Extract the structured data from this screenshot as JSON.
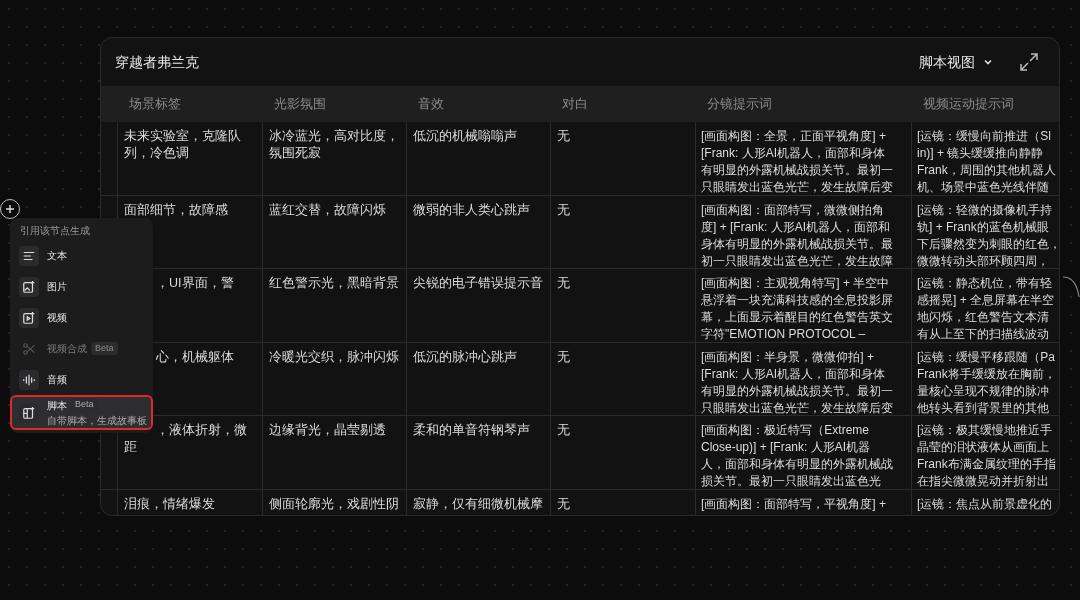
{
  "card": {
    "title": "穿越者弗兰克",
    "view_menu": "脚本视图"
  },
  "table": {
    "columns": [
      "场景标签",
      "光影氛围",
      "音效",
      "对白",
      "分镜提示词",
      "视频运动提示词"
    ],
    "rows": [
      {
        "partly_hidden": false,
        "cells": [
          [
            "未来实验室，克隆队",
            "列，冷色调"
          ],
          [
            "冰冷蓝光，高对比度，",
            "氛围死寂"
          ],
          [
            "低沉的机械嗡嗡声"
          ],
          [
            "无"
          ],
          [
            "[画面构图：全景，正面平视角度] +",
            "[Frank: 人形AI机器人，面部和身体",
            "有明显的外露机械战损关节。最初一",
            "只眼睛发出蓝色光芒，发生故障后变"
          ],
          [
            "[运镜：缓慢向前推进（Sl",
            "in)] + 镜头缓缓推向静静",
            "Frank，周围的其他机器人",
            "机、场景中蓝色光线伴随"
          ]
        ]
      },
      {
        "partly_hidden": false,
        "cells": [
          [
            "面部细节，故障感"
          ],
          [
            "蓝红交替，故障闪烁"
          ],
          [
            "微弱的非人类心跳声"
          ],
          [
            "无"
          ],
          [
            "[画面构图：面部特写，微微侧拍角",
            "度] + [Frank: 人形AI机器人，面部和",
            "身体有明显的外露机械战损关节。最",
            "初一只眼睛发出蓝色光芒，发生故障"
          ],
          [
            "[运镜：轻微的摄像机手持",
            "轨] + Frank的蓝色机械眼",
            "下后骤然变为刺眼的红色，",
            "微微转动头部环顾四周，"
          ]
        ]
      },
      {
        "partly_hidden": true,
        "cells": [
          [
            "，UI界面，警"
          ],
          [
            "红色警示光，黑暗背景"
          ],
          [
            "尖锐的电子错误提示音"
          ],
          [
            "无"
          ],
          [
            "[画面构图：主观视角特写] + 半空中",
            "悬浮着一块充满科技感的全息投影屏",
            "幕，上面显示着醒目的红色警告英文",
            "字符\"EMOTION PROTOCOL –"
          ],
          [
            "[运镜：静态机位，带有轻",
            "感摇晃] + 全息屏幕在半空",
            "地闪烁，红色警告文本清",
            "有从上至下的扫描线波动"
          ]
        ]
      },
      {
        "partly_hidden": true,
        "cells": [
          [
            "心，机械躯体"
          ],
          [
            "冷暖光交织，脉冲闪烁"
          ],
          [
            "低沉的脉冲心跳声"
          ],
          [
            "无"
          ],
          [
            "[画面构图：半身景，微微仰拍] +",
            "[Frank: 人形AI机器人，面部和身体",
            "有明显的外露机械战损关节。最初一",
            "只眼睛发出蓝色光芒，发生故障后变"
          ],
          [
            "[运镜：缓慢平移跟随（Pa",
            "Frank将手缓缓放在胸前，",
            "量核心呈现不规律的脉冲",
            "他转头看到背景里的其他"
          ]
        ]
      },
      {
        "partly_hidden": true,
        "cells": [
          [
            "，液体折射，微",
            "距"
          ],
          [
            "边缘背光，晶莹剔透"
          ],
          [
            "柔和的单音符钢琴声"
          ],
          [
            "无"
          ],
          [
            "[画面构图：极近特写（Extreme",
            "Close-up)] + [Frank: 人形AI机器",
            "人，面部和身体有明显的外露机械战",
            "损关节。最初一只眼睛发出蓝色光"
          ],
          [
            "[运镜：极其缓慢地推近手",
            "晶莹的泪状液体从画面上",
            "Frank布满金属纹理的手指",
            "在指尖微微晃动并折射出"
          ]
        ]
      },
      {
        "partly_hidden": false,
        "cells": [
          [
            "泪痕，情绪爆发"
          ],
          [
            "侧面轮廓光，戏剧性阴"
          ],
          [
            "寂静，仅有细微机械摩"
          ],
          [
            "无"
          ],
          [
            "[画面构图：面部特写，平视角度] +"
          ],
          [
            "[运镜：焦点从前景虚化的"
          ]
        ]
      }
    ]
  },
  "menu": {
    "title": "引用该节点生成",
    "items": [
      {
        "kind": "text",
        "label": "文本",
        "disabled": false,
        "highlighted": false
      },
      {
        "kind": "image",
        "label": "图片",
        "disabled": false,
        "highlighted": false
      },
      {
        "kind": "video",
        "label": "视频",
        "disabled": false,
        "highlighted": false
      },
      {
        "kind": "compose",
        "label": "视频合成",
        "badge": "Beta",
        "disabled": true,
        "highlighted": false
      },
      {
        "kind": "audio",
        "label": "音频",
        "disabled": false,
        "highlighted": false
      },
      {
        "kind": "script",
        "label": "脚本",
        "badge": "Beta",
        "subtitle": "自带脚本，生成故事板",
        "disabled": false,
        "highlighted": true
      }
    ]
  }
}
